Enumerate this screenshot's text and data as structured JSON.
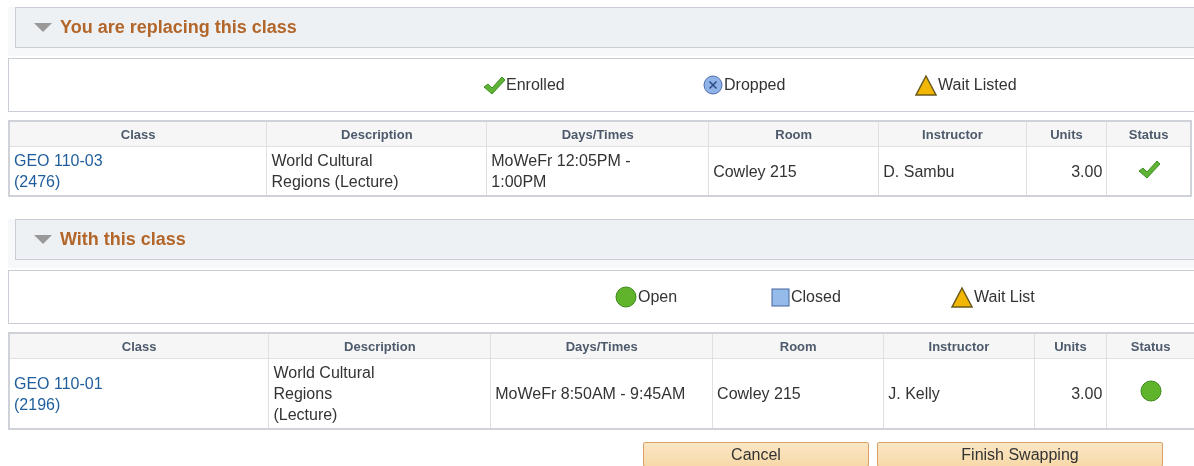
{
  "sections": [
    {
      "title": "You are replacing this class",
      "expanded": true,
      "legend": [
        {
          "kind": "enrolled",
          "label": "Enrolled"
        },
        {
          "kind": "dropped",
          "label": "Dropped"
        },
        {
          "kind": "waitlisted",
          "label": "Wait Listed"
        }
      ],
      "columns": [
        "Class",
        "Description",
        "Days/Times",
        "Room",
        "Instructor",
        "Units",
        "Status"
      ],
      "rows": [
        {
          "class": [
            "GEO 110-03",
            "(2476)"
          ],
          "description": [
            "World Cultural",
            "Regions (Lecture)"
          ],
          "days_times": [
            "MoWeFr 12:05PM -",
            "1:00PM"
          ],
          "room": "Cowley 215",
          "instructor": "D. Sambu",
          "units": "3.00",
          "kind": "enrolled"
        }
      ]
    },
    {
      "title": "With this class",
      "expanded": true,
      "legend": [
        {
          "kind": "open",
          "label": "Open"
        },
        {
          "kind": "closed",
          "label": "Closed"
        },
        {
          "kind": "waitlisted",
          "label": "Wait List"
        }
      ],
      "columns": [
        "Class",
        "Description",
        "Days/Times",
        "Room",
        "Instructor",
        "Units",
        "Status"
      ],
      "rows": [
        {
          "class": [
            "GEO 110-01",
            "(2196)"
          ],
          "description": [
            "World Cultural",
            "Regions",
            "(Lecture)"
          ],
          "days_times": [
            "MoWeFr 8:50AM - 9:45AM"
          ],
          "room": "Cowley 215",
          "instructor": "J. Kelly",
          "units": "3.00",
          "kind": "open"
        }
      ]
    }
  ],
  "buttons": [
    "Cancel",
    "Finish Swapping"
  ]
}
